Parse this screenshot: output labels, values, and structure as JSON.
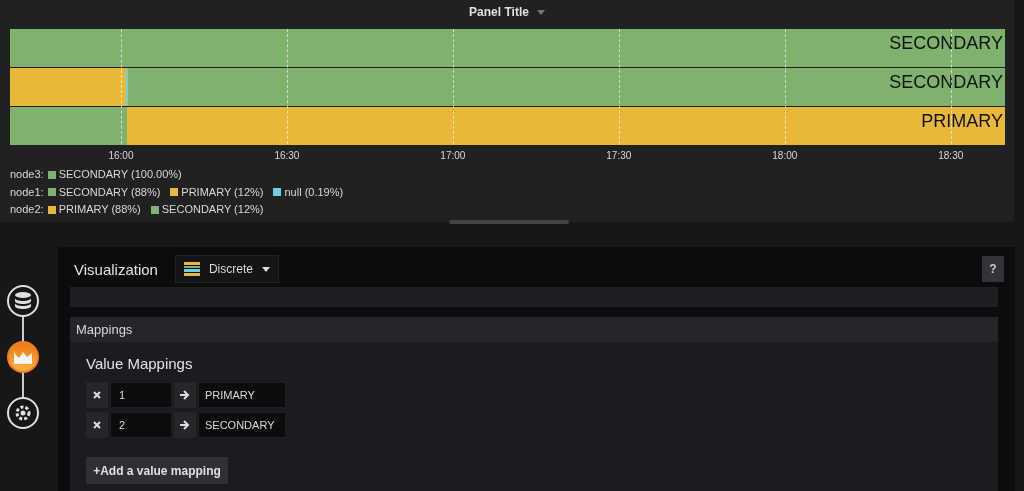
{
  "panel": {
    "title": "Panel Title"
  },
  "timeline": {
    "rows": [
      {
        "label": "SECONDARY",
        "segments": [
          {
            "color": "#7eb26d"
          }
        ]
      },
      {
        "label": "SECONDARY",
        "segments": [
          {
            "color": "#eab839"
          },
          {
            "color": "#6ed0e0"
          },
          {
            "color": "#7eb26d"
          }
        ]
      },
      {
        "label": "PRIMARY",
        "segments": [
          {
            "color": "#7eb26d"
          },
          {
            "color": "#eab839"
          }
        ]
      }
    ],
    "ticks": [
      "16:00",
      "16:30",
      "17:00",
      "17:30",
      "18:00",
      "18:30"
    ]
  },
  "legend": [
    {
      "series": "node3:",
      "items": [
        {
          "text": "SECONDARY (100.00%)",
          "color": "#7eb26d"
        }
      ]
    },
    {
      "series": "node1:",
      "items": [
        {
          "text": "SECONDARY (88%)",
          "color": "#7eb26d"
        },
        {
          "text": "PRIMARY (12%)",
          "color": "#eab839"
        },
        {
          "text": "null (0.19%)",
          "color": "#6ed0e0"
        }
      ]
    },
    {
      "series": "node2:",
      "items": [
        {
          "text": "PRIMARY (88%)",
          "color": "#eab839"
        },
        {
          "text": "SECONDARY (12%)",
          "color": "#7eb26d"
        }
      ]
    }
  ],
  "editor": {
    "steps": [
      {
        "kind": "queries",
        "selected": false
      },
      {
        "kind": "visualization",
        "selected": true
      },
      {
        "kind": "general",
        "selected": false
      }
    ],
    "visualization_label": "Visualization",
    "visualization": "Discrete",
    "help": "?",
    "section": "Mappings",
    "subheading": "Value Mappings",
    "mappings": [
      {
        "value": "1",
        "text": "PRIMARY"
      },
      {
        "value": "2",
        "text": "SECONDARY"
      }
    ],
    "add_button": "+Add a value mapping"
  }
}
